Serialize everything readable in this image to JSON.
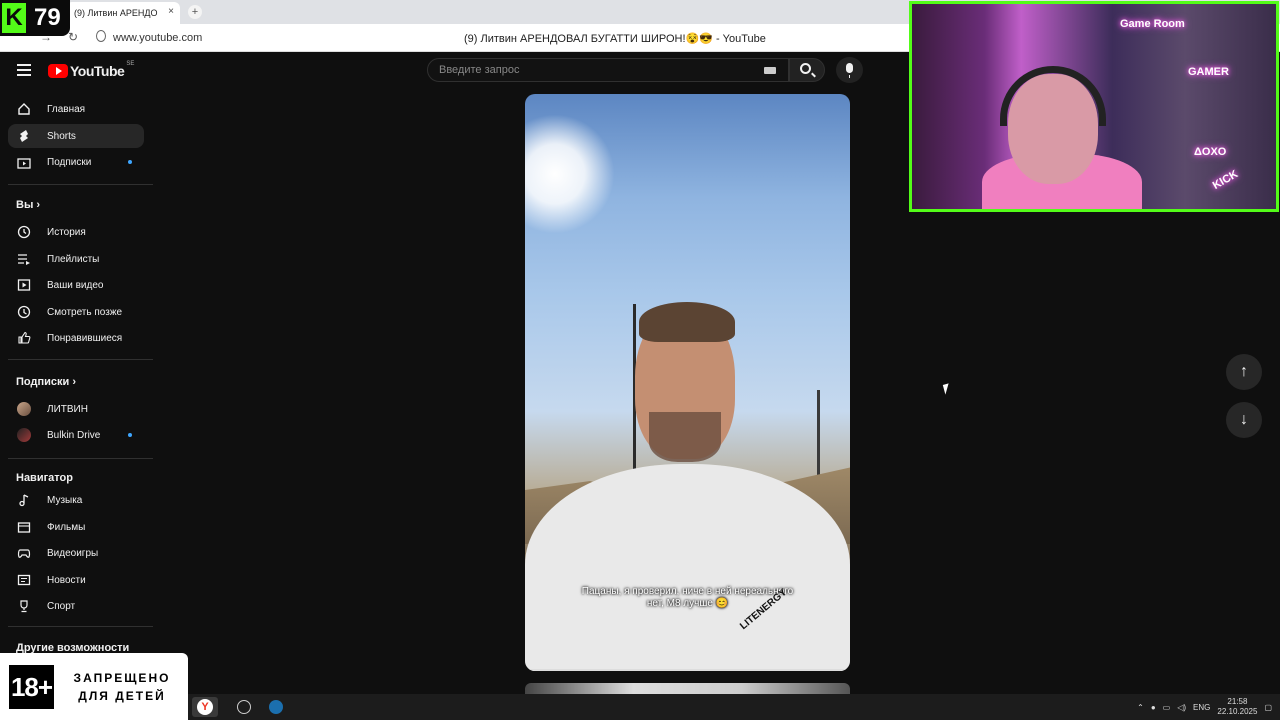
{
  "browser": {
    "tab_title": "(9) Литвин АРЕНДО",
    "tab_close": "×",
    "new_tab": "+",
    "url": "www.youtube.com",
    "page_title": "(9) Литвин АРЕНДОВАЛ БУГАТТИ ШИРОН!😵😎 - YouTube"
  },
  "kick_overlay": {
    "logo": "K",
    "count": "79"
  },
  "header": {
    "logo_text": "YouTube",
    "logo_region": "SE",
    "search_placeholder": "Введите запрос"
  },
  "sidebar": {
    "main": [
      {
        "label": "Главная",
        "icon": "home-icon"
      },
      {
        "label": "Shorts",
        "icon": "shorts-icon",
        "active": true
      },
      {
        "label": "Подписки",
        "icon": "subscriptions-icon",
        "dot": true
      }
    ],
    "you_heading": "Вы",
    "you": [
      {
        "label": "История",
        "icon": "history-icon"
      },
      {
        "label": "Плейлисты",
        "icon": "playlists-icon"
      },
      {
        "label": "Ваши видео",
        "icon": "your-videos-icon"
      },
      {
        "label": "Смотреть позже",
        "icon": "watch-later-icon"
      },
      {
        "label": "Понравившиеся",
        "icon": "liked-icon"
      }
    ],
    "subs_heading": "Подписки",
    "subs": [
      {
        "label": "ЛИТВИН",
        "dot": false
      },
      {
        "label": "Bulkin Drive",
        "dot": true
      }
    ],
    "nav_heading": "Навигатор",
    "nav": [
      {
        "label": "Музыка",
        "icon": "music-icon"
      },
      {
        "label": "Фильмы",
        "icon": "movies-icon"
      },
      {
        "label": "Видеоигры",
        "icon": "gaming-icon"
      },
      {
        "label": "Новости",
        "icon": "news-icon"
      },
      {
        "label": "Спорт",
        "icon": "sports-icon"
      }
    ],
    "more_heading": "Другие возможности"
  },
  "video": {
    "caption_line1": "Пацаны, я проверил, ниче в ней нереального",
    "caption_line2": "нет, М8 лучше 😊",
    "watermark": "LITENERGY",
    "progress": 0.99
  },
  "nav_arrows": {
    "up": "↑",
    "down": "↓"
  },
  "webcam": {
    "sign1": "Game Room",
    "sign2": "GAMER",
    "sign3": "ΔOXO",
    "sign4": "KICK"
  },
  "age_overlay": {
    "badge": "18+",
    "line1": "ЗАПРЕЩЕНО",
    "line2": "ДЛЯ ДЕТЕЙ"
  },
  "taskbar": {
    "lang": "ENG",
    "time": "21:58",
    "date": "22.10.2025"
  },
  "colors": {
    "accent_green": "#53fc18",
    "yt_red": "#ff0000",
    "dot_blue": "#3ea6ff"
  }
}
